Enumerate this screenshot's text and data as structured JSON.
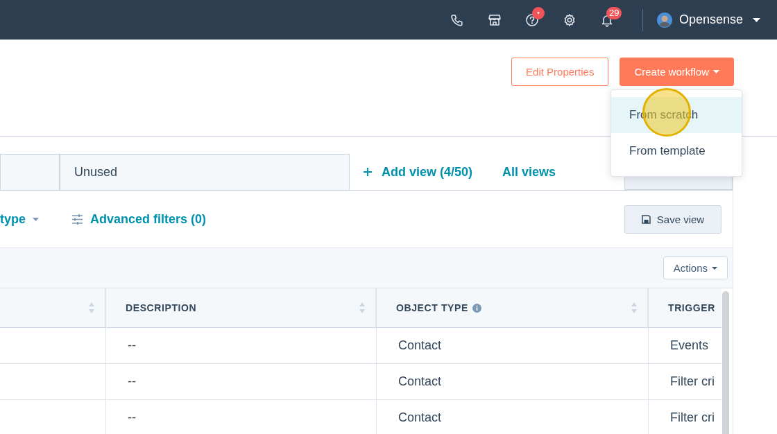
{
  "top_nav": {
    "help_badge": "•",
    "notifications_badge": "29",
    "account_name": "Opensense"
  },
  "header_buttons": [
    {
      "label": "Edit Properties",
      "kind": "secondary"
    },
    {
      "label": "Create workflow",
      "kind": "primary"
    }
  ],
  "create_menu": [
    {
      "label": "From scratch",
      "selected": true
    },
    {
      "label": "From template",
      "selected": false
    }
  ],
  "view_tabs": [
    {
      "label": "Unused",
      "selected": false
    }
  ],
  "view_links": [
    "Add view (4/50)",
    "All views"
  ],
  "filters": {
    "type_filter": "type",
    "advanced_filters": "Advanced filters (0)",
    "save_view": "Save view"
  },
  "actions_button": "Actions",
  "table": {
    "columns": [
      "",
      "DESCRIPTION",
      "OBJECT TYPE",
      "TRIGGER"
    ],
    "rows": [
      [
        "",
        "--",
        "Contact",
        "Events"
      ],
      [
        "",
        "--",
        "Contact",
        "Filter cri"
      ],
      [
        "",
        "--",
        "Contact",
        "Filter cri"
      ]
    ]
  }
}
